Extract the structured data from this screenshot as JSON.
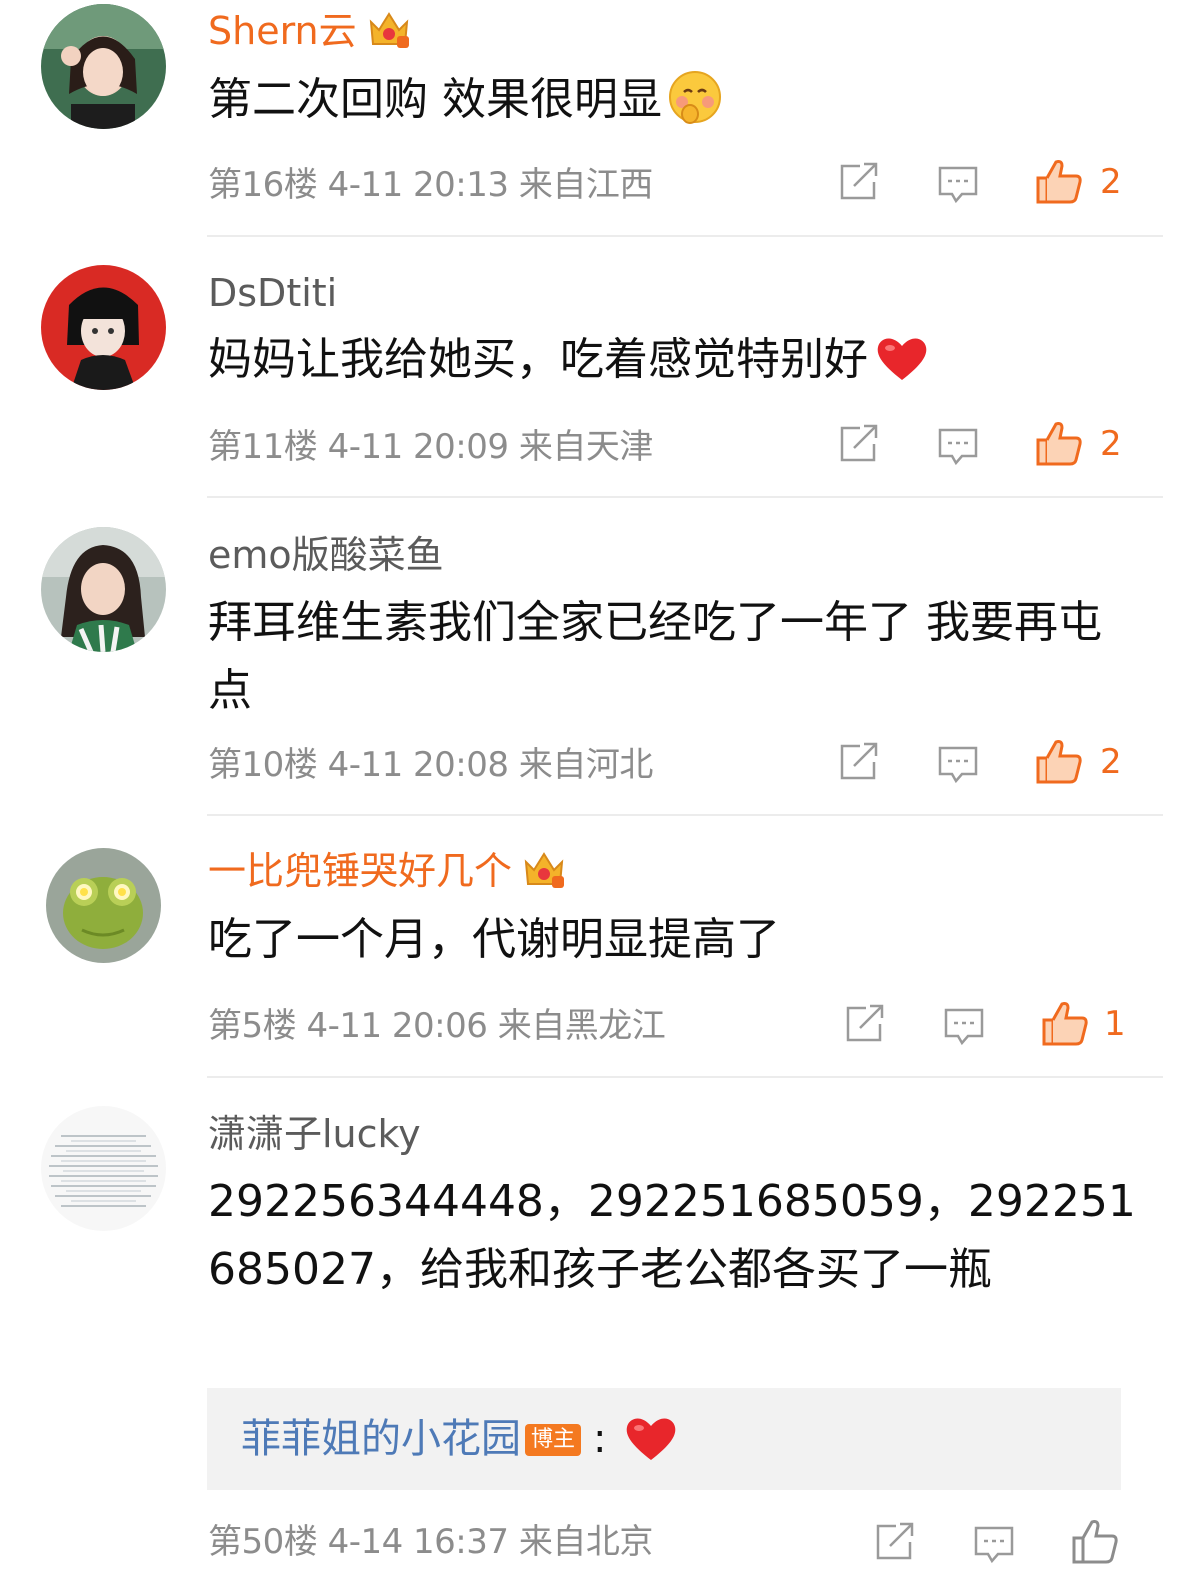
{
  "colors": {
    "accent": "#f06a1e",
    "link": "#4e7ab7",
    "meta": "#8c8c8c"
  },
  "comments": [
    {
      "username": "Shern云",
      "vip": true,
      "text": "第二次回购 效果很明显",
      "emoji": "shy-face-emoji",
      "meta": "第16楼 4-11 20:13 来自江西",
      "likes": "2"
    },
    {
      "username": "DsDtiti",
      "vip": false,
      "text": "妈妈让我给她买，吃着感觉特别好",
      "emoji": "red-heart-emoji",
      "meta": "第11楼 4-11 20:09 来自天津",
      "likes": "2"
    },
    {
      "username": "emo版酸菜鱼",
      "vip": false,
      "text": "拜耳维生素我们全家已经吃了一年了 我要再屯点",
      "meta": "第10楼 4-11 20:08 来自河北",
      "likes": "2"
    },
    {
      "username": "一比兜锤哭好几个",
      "vip": true,
      "text": "吃了一个月，代谢明显提高了",
      "meta": "第5楼 4-11 20:06 来自黑龙江",
      "likes": "1"
    },
    {
      "username": "潇潇子lucky",
      "vip": false,
      "text": "292256344448，292251685059，292251685027，给我和孩子老公都各买了一瓶",
      "meta": "第50楼 4-14 16:37 来自北京",
      "likes": "",
      "reply": {
        "user": "菲菲姐的小花园",
        "badge": "博主",
        "colon": ":",
        "emoji": "red-heart-emoji"
      }
    }
  ]
}
